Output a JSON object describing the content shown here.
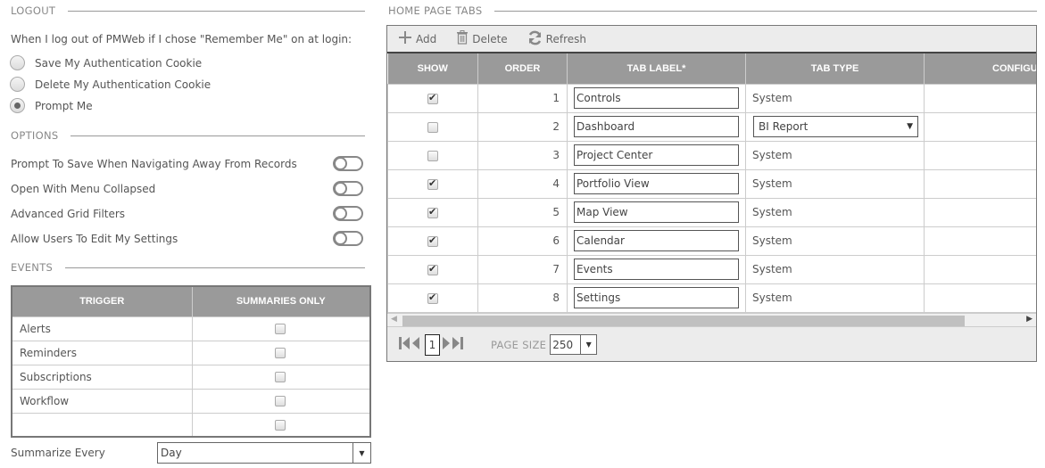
{
  "logout": {
    "title": "LOGOUT",
    "prompt": "When I log out of PMWeb if I chose \"Remember Me\" on at login:",
    "options": [
      {
        "label": "Save My Authentication Cookie",
        "checked": false
      },
      {
        "label": "Delete My Authentication Cookie",
        "checked": false
      },
      {
        "label": "Prompt Me",
        "checked": true
      }
    ]
  },
  "options": {
    "title": "OPTIONS",
    "items": [
      {
        "label": "Prompt To Save When Navigating Away From Records",
        "on": false
      },
      {
        "label": "Open With Menu Collapsed",
        "on": false
      },
      {
        "label": "Advanced Grid Filters",
        "on": false
      },
      {
        "label": "Allow Users To Edit My Settings",
        "on": false
      }
    ]
  },
  "events": {
    "title": "EVENTS",
    "columns": [
      "TRIGGER",
      "SUMMARIES ONLY"
    ],
    "rows": [
      {
        "trigger": "Alerts",
        "summaries_only": false
      },
      {
        "trigger": "Reminders",
        "summaries_only": false
      },
      {
        "trigger": "Subscriptions",
        "summaries_only": false
      },
      {
        "trigger": "Workflow",
        "summaries_only": false
      },
      {
        "trigger": "",
        "summaries_only": false
      }
    ],
    "summarize_label": "Summarize Every",
    "summarize_value": "Day"
  },
  "home_tabs": {
    "title": "HOME PAGE TABS",
    "toolbar": {
      "add": "Add",
      "delete": "Delete",
      "refresh": "Refresh"
    },
    "columns": [
      "SHOW",
      "ORDER",
      "TAB LABEL*",
      "TAB TYPE",
      "CONFIGURE"
    ],
    "rows": [
      {
        "show": true,
        "order": "1",
        "label": "Controls",
        "type": "System",
        "type_is_select": false
      },
      {
        "show": false,
        "order": "2",
        "label": "Dashboard",
        "type": "BI Report",
        "type_is_select": true
      },
      {
        "show": false,
        "order": "3",
        "label": "Project Center",
        "type": "System",
        "type_is_select": false
      },
      {
        "show": true,
        "order": "4",
        "label": "Portfolio View",
        "type": "System",
        "type_is_select": false
      },
      {
        "show": true,
        "order": "5",
        "label": "Map View",
        "type": "System",
        "type_is_select": false
      },
      {
        "show": true,
        "order": "6",
        "label": "Calendar",
        "type": "System",
        "type_is_select": false
      },
      {
        "show": true,
        "order": "7",
        "label": "Events",
        "type": "System",
        "type_is_select": false
      },
      {
        "show": true,
        "order": "8",
        "label": "Settings",
        "type": "System",
        "type_is_select": false
      }
    ],
    "pager": {
      "current_page": "1",
      "page_size_label": "PAGE SIZE",
      "page_size": "250"
    }
  }
}
